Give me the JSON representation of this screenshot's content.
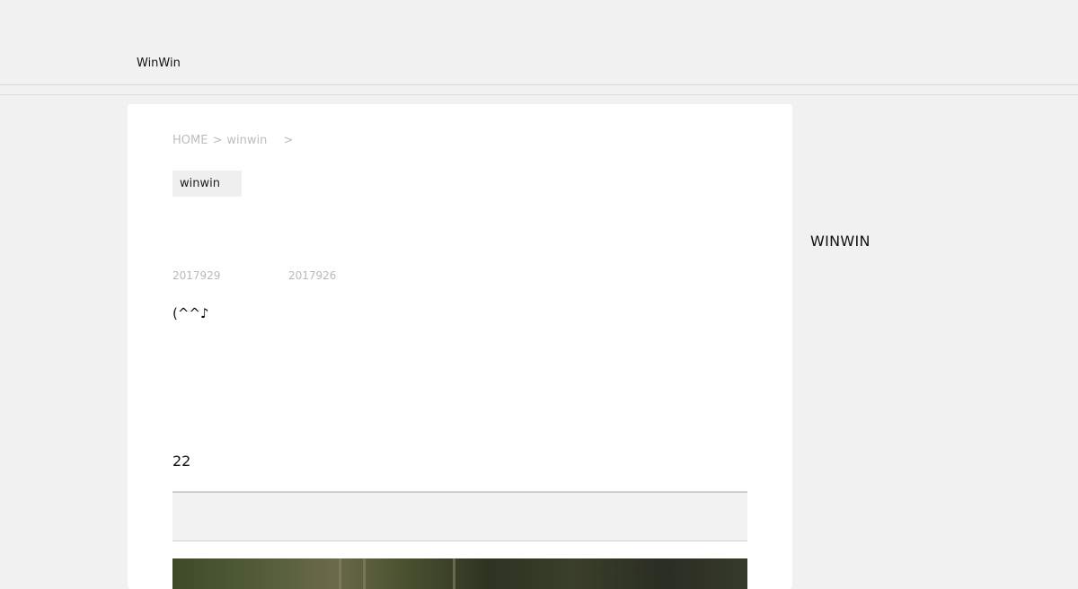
{
  "header": {
    "site_title": "WinWin"
  },
  "breadcrumb": {
    "home": "HOME",
    "separator_1": ">",
    "category": "winwin",
    "separator_2": ">"
  },
  "post": {
    "category_tag": "winwin",
    "date_published": "2017929",
    "date_updated": "2017926",
    "excerpt": "(^^♪",
    "section_heading": "22"
  },
  "sidebar": {
    "title": "WINWIN"
  }
}
